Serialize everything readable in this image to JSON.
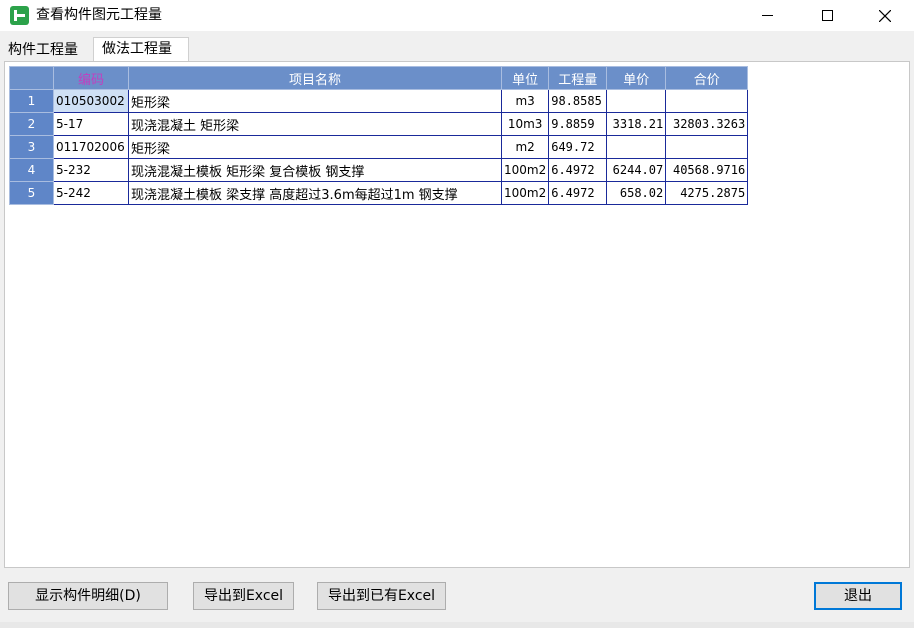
{
  "window": {
    "title": "查看构件图元工程量"
  },
  "tabs": [
    {
      "label": "构件工程量"
    },
    {
      "label": "做法工程量"
    }
  ],
  "table": {
    "headers": {
      "code": "编码",
      "name": "项目名称",
      "unit": "单位",
      "qty": "工程量",
      "price": "单价",
      "total": "合价"
    },
    "rows": [
      {
        "n": "1",
        "code": "010503002",
        "name": "矩形梁",
        "unit": "m3",
        "qty": "98.8585",
        "price": "",
        "total": ""
      },
      {
        "n": "2",
        "code": "5-17",
        "name": "现浇混凝土 矩形梁",
        "unit": "10m3",
        "qty": "9.8859",
        "price": "3318.21",
        "total": "32803.3263"
      },
      {
        "n": "3",
        "code": "011702006",
        "name": "矩形梁",
        "unit": "m2",
        "qty": "649.72",
        "price": "",
        "total": ""
      },
      {
        "n": "4",
        "code": "5-232",
        "name": "现浇混凝土模板 矩形梁 复合模板 钢支撑",
        "unit": "100m2",
        "qty": "6.4972",
        "price": "6244.07",
        "total": "40568.9716"
      },
      {
        "n": "5",
        "code": "5-242",
        "name": "现浇混凝土模板 梁支撑 高度超过3.6m每超过1m 钢支撑",
        "unit": "100m2",
        "qty": "6.4972",
        "price": "658.02",
        "total": "4275.2875"
      }
    ]
  },
  "buttons": {
    "show_detail": "显示构件明细(D)",
    "export_excel": "导出到Excel",
    "export_existing": "导出到已有Excel",
    "exit": "退出"
  },
  "icons": {
    "app": "app-logo-icon",
    "minimize": "minimize-icon",
    "maximize": "maximize-icon",
    "close": "close-icon"
  },
  "colors": {
    "header_bg": "#6b8fc9",
    "grid_line": "#1a2a9a",
    "code_header": "#c040c0",
    "app_icon": "#2ca24a"
  }
}
